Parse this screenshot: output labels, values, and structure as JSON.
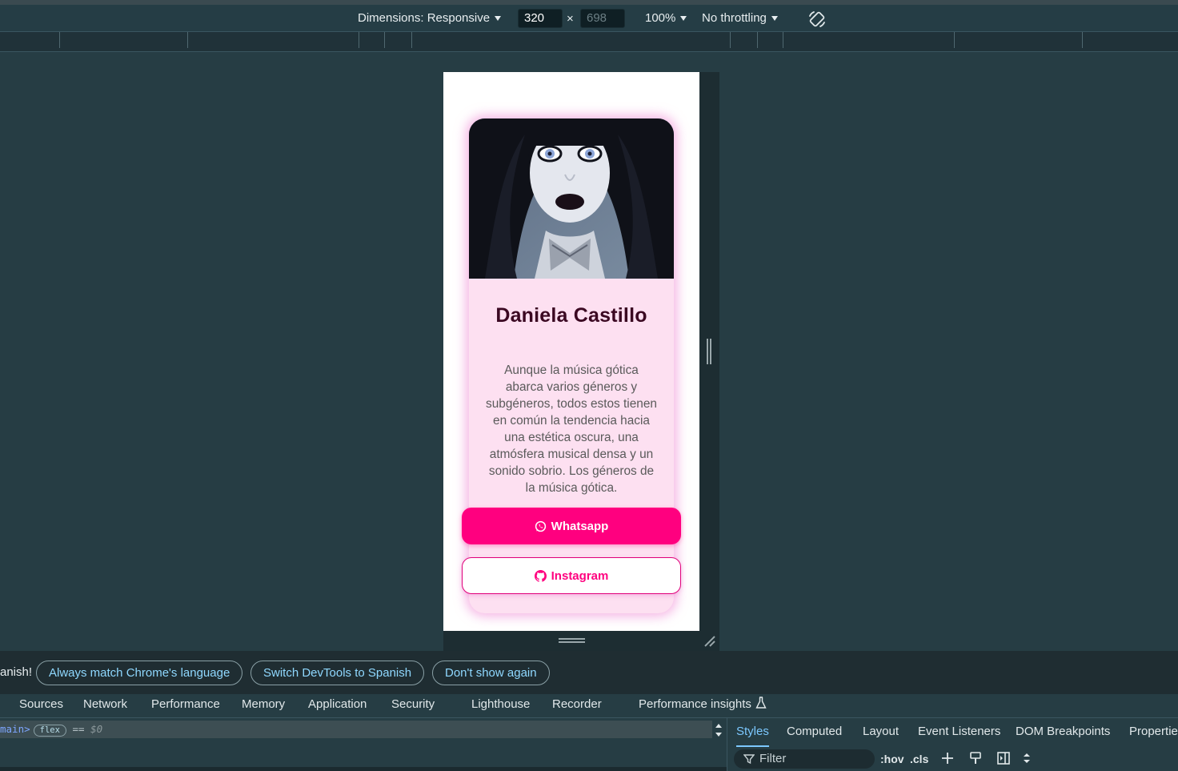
{
  "toolbar": {
    "dimensions_label": "Dimensions: Responsive",
    "width_value": "320",
    "height_placeholder": "698",
    "times_symbol": "×",
    "zoom": "100%",
    "throttling": "No throttling",
    "rotate_icon": "rotate-icon"
  },
  "card": {
    "name": "Daniela Castillo",
    "description": "Aunque la música gótica abarca varios géneros y subgéneros, todos estos tienen en común la tendencia hacia una estética oscura, una atmósfera musical densa y un sonido sobrio. Los géneros de la música gótica.",
    "whatsapp_label": "Whatsapp",
    "instagram_label": "Instagram",
    "whatsapp_icon": "whatsapp-icon",
    "instagram_icon": "github-icon",
    "accent_color": "#ff007f",
    "card_bg": "#fde0f1",
    "name_color": "#3b0822"
  },
  "infobar": {
    "text": "anish!",
    "buttons": [
      "Always match Chrome's language",
      "Switch DevTools to Spanish",
      "Don't show again"
    ]
  },
  "tabs": [
    "Sources",
    "Network",
    "Performance",
    "Memory",
    "Application",
    "Security",
    "Lighthouse",
    "Recorder",
    "Performance insights"
  ],
  "breadcrumb": {
    "tag": "main>",
    "badge": "flex",
    "equals": "==",
    "dollar": "$0"
  },
  "styles_panel": {
    "tabs": [
      "Styles",
      "Computed",
      "Layout",
      "Event Listeners",
      "DOM Breakpoints",
      "Properties"
    ],
    "active_tab": "Styles",
    "filter_placeholder": "Filter",
    "hov": ":hov",
    "cls": ".cls"
  }
}
